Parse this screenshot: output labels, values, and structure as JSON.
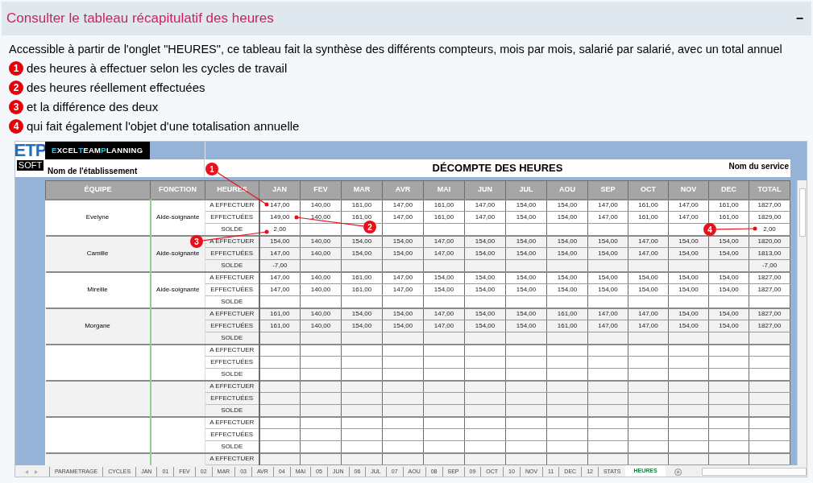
{
  "panel": {
    "title": "Consulter le tableau récapitulatif des heures",
    "collapse_symbol": "−"
  },
  "intro": "Accessible à partir de l'onglet \"HEURES\", ce tableau fait la synthèse des différents compteurs, mois par mois, salarié par salarié, avec un total annuel",
  "points": [
    {
      "number": "1",
      "text": "des heures à effectuer selon les cycles de travail"
    },
    {
      "number": "2",
      "text": "des heures réellement effectuées"
    },
    {
      "number": "3",
      "text": "et la différence des deux"
    },
    {
      "number": "4",
      "text": "qui fait également l'objet d'une totalisation annuelle"
    }
  ],
  "spreadsheet": {
    "logo": {
      "mark": "ETP",
      "sub": "SOFT",
      "name_parts": [
        {
          "text": "E",
          "accent": true
        },
        {
          "text": "XCEL",
          "accent": false
        },
        {
          "text": "T",
          "accent": true
        },
        {
          "text": "EAM",
          "accent": false
        },
        {
          "text": "P",
          "accent": true
        },
        {
          "text": "LANNING",
          "accent": false
        }
      ]
    },
    "establishment": "Nom de l'établissement",
    "title": "DÉCOMPTE DES HEURES",
    "service": "Nom du service",
    "columns": [
      "ÉQUIPE",
      "FONCTION",
      "HEURES",
      "JAN",
      "FEV",
      "MAR",
      "AVR",
      "MAI",
      "JUN",
      "JUL",
      "AOU",
      "SEP",
      "OCT",
      "NOV",
      "DEC",
      "TOTAL"
    ],
    "groups": [
      {
        "name": "Evelyne",
        "function": "Aide-soignante",
        "rows": [
          {
            "label": "A EFFECTUER",
            "values": [
              "147,00",
              "140,00",
              "161,00",
              "147,00",
              "161,00",
              "147,00",
              "154,00",
              "154,00",
              "147,00",
              "161,00",
              "147,00",
              "161,00",
              "1827,00"
            ]
          },
          {
            "label": "EFFECTUÉES",
            "values": [
              "149,00",
              "140,00",
              "161,00",
              "147,00",
              "161,00",
              "147,00",
              "154,00",
              "154,00",
              "147,00",
              "161,00",
              "147,00",
              "161,00",
              "1829,00"
            ]
          },
          {
            "label": "SOLDE",
            "jan": "2,00",
            "total": "2,00"
          }
        ]
      },
      {
        "name": "Camille",
        "function": "Aide-soignante",
        "rows": [
          {
            "label": "A EFFECTUER",
            "values": [
              "154,00",
              "140,00",
              "154,00",
              "154,00",
              "147,00",
              "154,00",
              "154,00",
              "154,00",
              "154,00",
              "147,00",
              "154,00",
              "154,00",
              "1820,00"
            ]
          },
          {
            "label": "EFFECTUÉES",
            "values": [
              "147,00",
              "140,00",
              "154,00",
              "154,00",
              "147,00",
              "154,00",
              "154,00",
              "154,00",
              "154,00",
              "147,00",
              "154,00",
              "154,00",
              "1813,00"
            ]
          },
          {
            "label": "SOLDE",
            "jan": "-7,00",
            "total": "-7,00"
          }
        ]
      },
      {
        "name": "Mireille",
        "function": "Aide-soignante",
        "rows": [
          {
            "label": "A EFFECTUER",
            "values": [
              "147,00",
              "140,00",
              "161,00",
              "147,00",
              "154,00",
              "154,00",
              "154,00",
              "154,00",
              "154,00",
              "154,00",
              "154,00",
              "154,00",
              "1827,00"
            ]
          },
          {
            "label": "EFFECTUÉES",
            "values": [
              "147,00",
              "140,00",
              "161,00",
              "147,00",
              "154,00",
              "154,00",
              "154,00",
              "154,00",
              "154,00",
              "154,00",
              "154,00",
              "154,00",
              "1827,00"
            ]
          },
          {
            "label": "SOLDE"
          }
        ]
      },
      {
        "name": "Morgane",
        "rows": [
          {
            "label": "A EFFECTUER",
            "values": [
              "161,00",
              "140,00",
              "154,00",
              "154,00",
              "147,00",
              "154,00",
              "154,00",
              "161,00",
              "147,00",
              "147,00",
              "154,00",
              "154,00",
              "1827,00"
            ]
          },
          {
            "label": "EFFECTUÉES",
            "values": [
              "161,00",
              "140,00",
              "154,00",
              "154,00",
              "147,00",
              "154,00",
              "154,00",
              "161,00",
              "147,00",
              "147,00",
              "154,00",
              "154,00",
              "1827,00"
            ]
          },
          {
            "label": "SOLDE"
          }
        ]
      },
      {
        "rows": [
          {
            "label": "A EFFECTUER"
          },
          {
            "label": "EFFECTUÉES"
          },
          {
            "label": "SOLDE"
          }
        ]
      },
      {
        "rows": [
          {
            "label": "A EFFECTUER"
          },
          {
            "label": "EFFECTUÉES"
          },
          {
            "label": "SOLDE"
          }
        ]
      },
      {
        "rows": [
          {
            "label": "A EFFECTUER"
          },
          {
            "label": "EFFECTUÉES"
          },
          {
            "label": "SOLDE"
          }
        ]
      },
      {
        "rows": [
          {
            "label": "A EFFECTUER"
          }
        ]
      }
    ],
    "callouts": [
      {
        "number": "1"
      },
      {
        "number": "2"
      },
      {
        "number": "3"
      },
      {
        "number": "4"
      }
    ],
    "sheet_tabs": [
      {
        "label": "PARAMETRAGE",
        "selected": false
      },
      {
        "label": "CYCLES",
        "selected": false
      },
      {
        "label": "JAN",
        "selected": false
      },
      {
        "label": "01",
        "selected": false
      },
      {
        "label": "FEV",
        "selected": false
      },
      {
        "label": "02",
        "selected": false
      },
      {
        "label": "MAR",
        "selected": false
      },
      {
        "label": "03",
        "selected": false
      },
      {
        "label": "AVR",
        "selected": false
      },
      {
        "label": "04",
        "selected": false
      },
      {
        "label": "MAI",
        "selected": false
      },
      {
        "label": "05",
        "selected": false
      },
      {
        "label": "JUN",
        "selected": false
      },
      {
        "label": "06",
        "selected": false
      },
      {
        "label": "JUL",
        "selected": false
      },
      {
        "label": "07",
        "selected": false
      },
      {
        "label": "AOU",
        "selected": false
      },
      {
        "label": "08",
        "selected": false
      },
      {
        "label": "SEP",
        "selected": false
      },
      {
        "label": "09",
        "selected": false
      },
      {
        "label": "OCT",
        "selected": false
      },
      {
        "label": "10",
        "selected": false
      },
      {
        "label": "NOV",
        "selected": false
      },
      {
        "label": "11",
        "selected": false
      },
      {
        "label": "DEC",
        "selected": false
      },
      {
        "label": "12",
        "selected": false
      },
      {
        "label": "STATS",
        "selected": false
      },
      {
        "label": "HEURES",
        "selected": true
      }
    ]
  }
}
